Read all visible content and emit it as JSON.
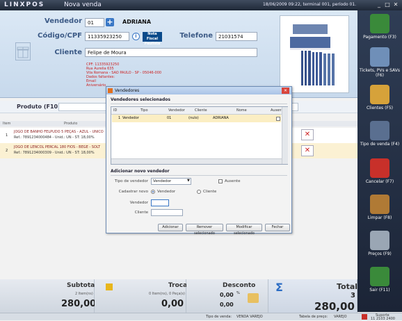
{
  "titlebar": {
    "logo": "LINXPOS",
    "title": "Nova venda",
    "status": "18/06/2009 09:22, terminal 001, período 01.",
    "min": "_",
    "max": "□",
    "close": "✕"
  },
  "sale": {
    "vendedor_label": "Vendedor",
    "vendedor_code": "01",
    "vendedor_name": "ADRIANA",
    "cpf_label": "Código/CPF",
    "cpf_value": "11335923250",
    "telefone_label": "Telefone",
    "telefone_value": "21031574",
    "cliente_label": "Cliente",
    "cliente_value": "Felipe de Moura",
    "nota_paulista": "Nota Fiscal Paulista",
    "client_info": [
      "CPF: 11335923250",
      "Rua Aurelia 635",
      "Vila Romana - SAO PAULO - SP - 05046-000",
      "",
      "Dados faltantes:",
      "Email",
      "Aniversário"
    ]
  },
  "produto": {
    "label": "Produto (F10)"
  },
  "grid": {
    "headers": {
      "item": "Item",
      "produto": "Produto"
    },
    "rows": [
      {
        "n": "1",
        "desc": "JOGO DE BANHO FELPUDO 5 PEÇAS - AZUL - UNICO",
        "ref": "Ref.: 7891234000484 - Unid.: UN - ST: 18,00%"
      },
      {
        "n": "2",
        "desc": "JOGO DE LENCOL PERCAL 180 FIOS - BEGE - SOLT",
        "ref": "Ref.: 7891234000309 - Unid.: UN - ST: 18,00%"
      }
    ]
  },
  "sidebar": [
    {
      "label": "Pagamento (F3)",
      "icon": "calculator-icon",
      "color": "#3a8a3a"
    },
    {
      "label": "Tickets, PVs e SAVs (F6)",
      "icon": "tickets-icon",
      "color": "#6f8fb8"
    },
    {
      "label": "Clientes (F5)",
      "icon": "folder-icon",
      "color": "#d6a23a"
    },
    {
      "label": "Tipo de venda (F4)",
      "icon": "sale-type-icon",
      "color": "#5a6f90"
    },
    {
      "label": "Cancelar (F7)",
      "icon": "cancel-icon",
      "color": "#c8302a"
    },
    {
      "label": "Limpar (F8)",
      "icon": "broom-icon",
      "color": "#b07a35"
    },
    {
      "label": "Preços (F9)",
      "icon": "prices-icon",
      "color": "#9aa6b4"
    },
    {
      "label": "Sair (F11)",
      "icon": "exit-icon",
      "color": "#3a8a3a"
    }
  ],
  "footer": {
    "subtotal": {
      "title": "Subtotal",
      "sub": "2 Item(ns)",
      "value": "280,00"
    },
    "troca": {
      "title": "Troca",
      "sub": "0 Item(ns), 0 Peça(s)",
      "value": "0,00"
    },
    "desconto": {
      "title": "Desconto",
      "pct": "0,00",
      "pct_sign": "%",
      "value": "0,00"
    },
    "total": {
      "title": "Total",
      "count": "3",
      "value": "280,00"
    }
  },
  "statusbar": {
    "support": "Suporte",
    "phone": "11 2103 2400",
    "tipo_label": "Tipo de venda:",
    "tipo_value": "VENDA VAREJO",
    "tabela_label": "Tabela de preço:",
    "tabela_value": "VAREJO"
  },
  "dialog": {
    "title": "Vendedores",
    "selected_heading": "Vendedores selecionados",
    "columns": {
      "id": "ID",
      "tipo": "Tipo",
      "vendedor": "Vendedor",
      "cliente": "Cliente",
      "nome": "Nome",
      "ausente": "Ausente"
    },
    "rows": [
      {
        "id": "1",
        "tipo": "Vendedor",
        "vendedor": "01",
        "cliente": "(nulo)",
        "nome": "ADRIANA"
      }
    ],
    "add_heading": "Adicionar novo vendedor",
    "tipo_label": "Tipo de vendedor",
    "tipo_value": "Vendedor",
    "ausente_label": "Ausente",
    "cadastrar_label": "Cadastrar novo",
    "radio_vendedor": "Vendedor",
    "radio_cliente": "Cliente",
    "vendedor_label": "Vendedor",
    "cliente_label": "Cliente",
    "buttons": {
      "adicionar": "Adicionar",
      "remover": "Remover selecionado",
      "modificar": "Modificar selecionado",
      "fechar": "Fechar"
    }
  }
}
